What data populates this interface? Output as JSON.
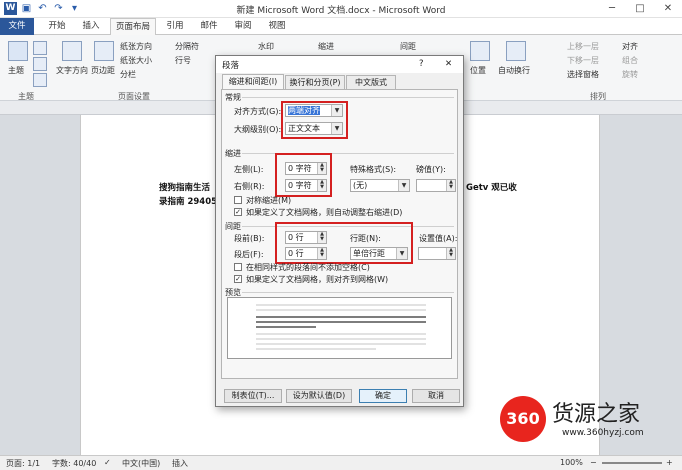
{
  "window": {
    "title": "新建 Microsoft Word 文档.docx - Microsoft Word",
    "controls": {
      "minimize": "─",
      "maximize": "□",
      "close": "✕"
    }
  },
  "ribbon_tabs": [
    "文件",
    "开始",
    "插入",
    "页面布局",
    "引用",
    "邮件",
    "审阅",
    "视图"
  ],
  "ribbon": {
    "theme": "主题",
    "text_direction": "文字方向",
    "margins": "页边距",
    "orientation": "纸张方向",
    "size": "纸张大小",
    "columns": "分栏",
    "breaks": "分隔符",
    "line_numbers": "行号",
    "watermark": "水印",
    "indent": "缩进",
    "spacing": "间距",
    "position": "位置",
    "wrap": "自动换行",
    "bring_forward": "上移一层",
    "send_backward": "下移一层",
    "selection_pane": "选择窗格",
    "align": "对齐",
    "group": "组合",
    "rotate": "旋转",
    "group_themes": "主题",
    "group_page_setup": "页面设置",
    "group_arrange": "排列"
  },
  "document": {
    "line1_left": "搜狗指南生活",
    "line1_right": "Getv 观已收",
    "line2_left": "录指南 294056"
  },
  "dialog": {
    "title": "段落",
    "help": "?",
    "close": "✕",
    "tabs": [
      "缩进和间距(I)",
      "换行和分页(P)",
      "中文版式(H)"
    ],
    "general": {
      "label": "常规",
      "alignment_label": "对齐方式(G):",
      "alignment_value": "两端对齐",
      "outline_label": "大纲级别(O):",
      "outline_value": "正文文本"
    },
    "indent": {
      "label": "缩进",
      "left_label": "左侧(L):",
      "left_value": "0 字符",
      "right_label": "右侧(R):",
      "right_value": "0 字符",
      "special_label": "特殊格式(S):",
      "special_value": "(无)",
      "by_label": "磅值(Y):",
      "mirror": "对称缩进(M)",
      "auto_adjust": "如果定义了文档网格，则自动调整右缩进(D)"
    },
    "spacing": {
      "label": "间距",
      "before_label": "段前(B):",
      "before_value": "0 行",
      "after_label": "段后(F):",
      "after_value": "0 行",
      "line_label": "行距(N):",
      "line_value": "单倍行距",
      "at_label": "设置值(A):",
      "no_space_same_style": "在相同样式的段落间不添加空格(C)",
      "snap_grid": "如果定义了文档网格，则对齐到网格(W)"
    },
    "preview": {
      "label": "预览"
    },
    "buttons": {
      "tabs": "制表位(T)...",
      "default": "设为默认值(D)",
      "ok": "确定",
      "cancel": "取消"
    },
    "checked": {
      "mirror": false,
      "auto_adjust": true,
      "no_space_same_style": false,
      "snap_grid": true
    }
  },
  "status": {
    "page": "页面: 1/1",
    "words": "字数: 40/40",
    "language": "中文(中国)",
    "mode": "插入",
    "zoom": "100%"
  },
  "watermark": {
    "logo": "360",
    "name": "货源之家",
    "url": "www.360hyzj.com"
  },
  "colors": {
    "file_tab": "#2b579a",
    "highlight": "#d42020",
    "selected_text": "#3875d7"
  }
}
